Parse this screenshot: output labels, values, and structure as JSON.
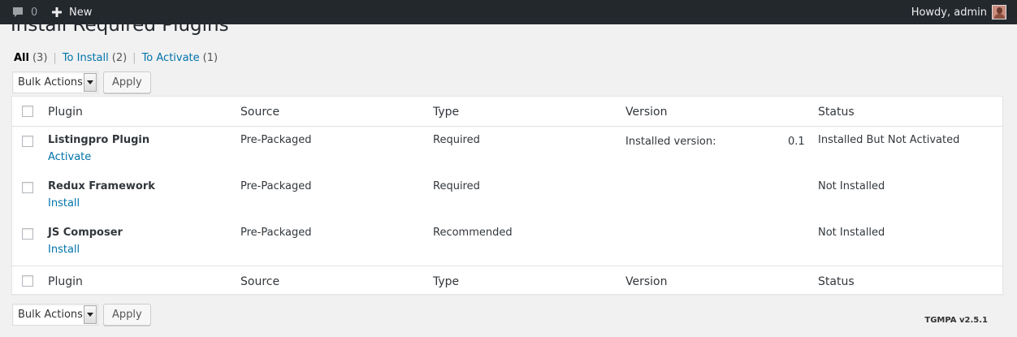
{
  "adminbar": {
    "comments_count": "0",
    "new_label": "New",
    "howdy": "Howdy, admin"
  },
  "page": {
    "title": "Install Required Plugins"
  },
  "filters": [
    {
      "label": "All",
      "count": "(3)"
    },
    {
      "label": "To Install",
      "count": "(2)"
    },
    {
      "label": "To Activate",
      "count": "(1)"
    }
  ],
  "bulk": {
    "select_value": "Bulk Actions",
    "apply_label": "Apply"
  },
  "columns": {
    "plugin": "Plugin",
    "source": "Source",
    "type": "Type",
    "version": "Version",
    "status": "Status"
  },
  "rows": [
    {
      "name": "Listingpro Plugin",
      "action": "Activate",
      "source": "Pre-Packaged",
      "type": "Required",
      "version_label": "Installed version:",
      "version_value": "0.1",
      "status": "Installed But Not Activated"
    },
    {
      "name": "Redux Framework",
      "action": "Install",
      "source": "Pre-Packaged",
      "type": "Required",
      "version_label": "",
      "version_value": "",
      "status": "Not Installed"
    },
    {
      "name": "JS Composer",
      "action": "Install",
      "source": "Pre-Packaged",
      "type": "Recommended",
      "version_label": "",
      "version_value": "",
      "status": "Not Installed"
    }
  ],
  "footer": {
    "version": "TGMPA v2.5.1"
  }
}
